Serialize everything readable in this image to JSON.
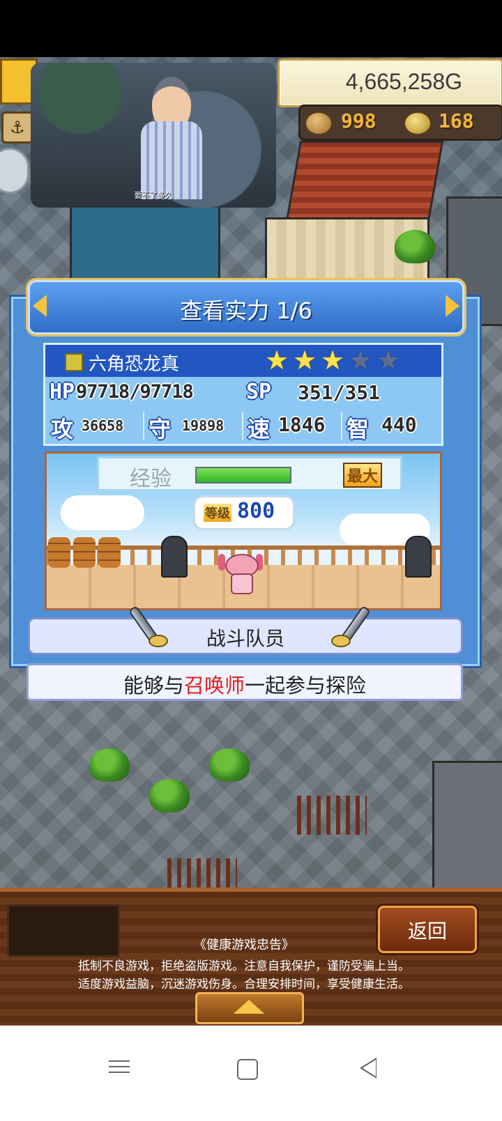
{
  "currency": {
    "gold": "4,665,258G",
    "coins": "998",
    "medals": "168"
  },
  "video_overlay": {
    "caption": "要不了多久"
  },
  "dialog": {
    "title": "查看实力 1/6",
    "character": {
      "name": "六角恐龙真",
      "stars_filled": 3,
      "stars_total": 5,
      "hp_label": "HP",
      "hp": "97718/97718",
      "sp_label": "SP",
      "sp": "351/351",
      "attack_label": "攻",
      "attack": "36658",
      "defense_label": "守",
      "defense": "19898",
      "speed_label": "速",
      "speed": "1846",
      "intelligence_label": "智",
      "intelligence": "440"
    },
    "experience": {
      "label": "经验",
      "progress": 1.0,
      "max_label": "最大"
    },
    "level": {
      "label": "等级",
      "value": "800"
    },
    "role": "战斗队员",
    "description": {
      "before": "能够与",
      "highlight": "召唤师",
      "after": "一起参与探险"
    }
  },
  "footer": {
    "back_button": "返回",
    "notice_title": "《健康游戏忠告》",
    "notice_line1": "抵制不良游戏，拒绝盗版游戏。注意自我保护，谨防受骗上当。",
    "notice_line2": "适度游戏益脑，沉迷游戏伤身。合理安排时间，享受健康生活。"
  },
  "colors": {
    "highlight": "#e02020",
    "dialog_blue": "#4e8fd6",
    "star_on": "#ffe34a"
  }
}
